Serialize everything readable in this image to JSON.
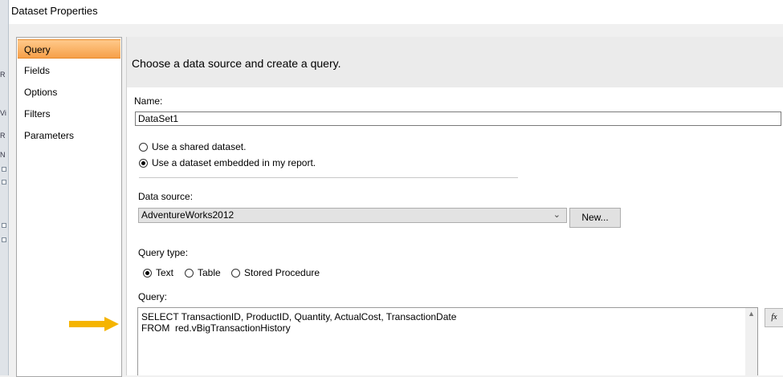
{
  "window": {
    "title": "Dataset Properties"
  },
  "nav": {
    "items": [
      {
        "label": "Query",
        "active": true
      },
      {
        "label": "Fields",
        "active": false
      },
      {
        "label": "Options",
        "active": false
      },
      {
        "label": "Filters",
        "active": false
      },
      {
        "label": "Parameters",
        "active": false
      }
    ]
  },
  "content": {
    "header": "Choose a data source and create a query.",
    "name_label": "Name:",
    "name_value": "DataSet1",
    "dataset_options": [
      {
        "label": "Use a shared dataset.",
        "checked": false
      },
      {
        "label": "Use a dataset embedded in my report.",
        "checked": true
      }
    ],
    "data_source_label": "Data source:",
    "data_source_value": "AdventureWorks2012",
    "new_button": "New...",
    "query_type_label": "Query type:",
    "query_types": [
      {
        "label": "Text",
        "checked": true
      },
      {
        "label": "Table",
        "checked": false
      },
      {
        "label": "Stored Procedure",
        "checked": false
      }
    ],
    "query_label": "Query:",
    "query_lines": [
      "SELECT TransactionID, ProductID, Quantity, ActualCost, TransactionDate",
      "FROM  red.vBigTransactionHistory"
    ],
    "expression_button": "fx"
  },
  "background_app": {
    "edge_glyphs": [
      "R",
      "Vi",
      "R",
      "N"
    ]
  },
  "colors": {
    "active_nav": "#f6a04a",
    "arrow": "#f5b400"
  }
}
